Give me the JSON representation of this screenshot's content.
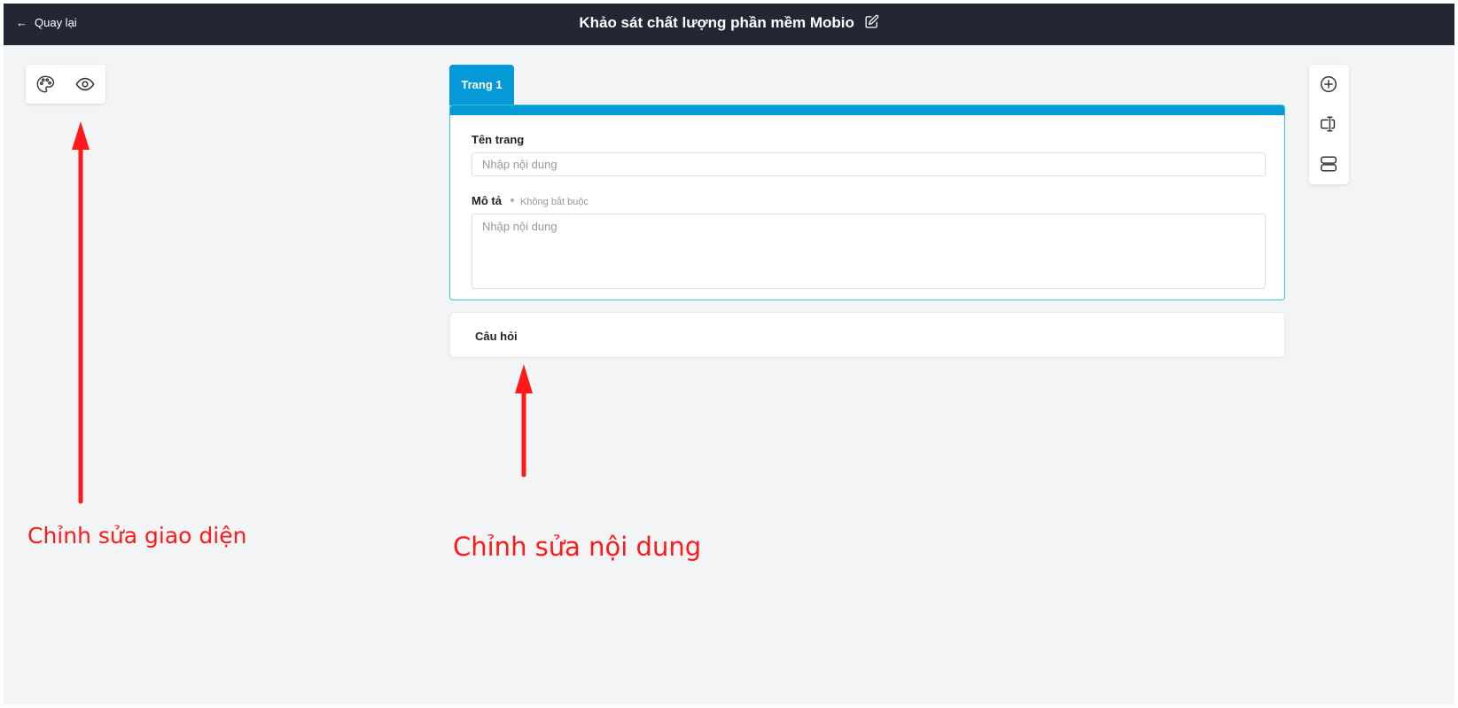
{
  "topbar": {
    "back_label": "Quay lại",
    "title": "Khảo sát chất lượng phần mềm Mobio"
  },
  "left_toolbar": {
    "tools": [
      "palette-icon",
      "eye-icon"
    ]
  },
  "right_toolbar": {
    "tools": [
      "plus-circle-icon",
      "text-cursor-icon",
      "section-icon"
    ]
  },
  "page": {
    "tab_label": "Trang 1",
    "name_label": "Tên trang",
    "name_placeholder": "Nhập nội dung",
    "desc_label": "Mô tả",
    "desc_optional": "Không bắt buộc",
    "desc_placeholder": "Nhập nội dung"
  },
  "question": {
    "label": "Câu hỏi"
  },
  "annotations": {
    "left": "Chỉnh sửa giao diện",
    "right": "Chỉnh sửa nội dung"
  },
  "colors": {
    "topbar_bg": "#232733",
    "accent": "#0599d8",
    "card_border": "#34c3d2",
    "annotation": "#ff1a1a"
  }
}
